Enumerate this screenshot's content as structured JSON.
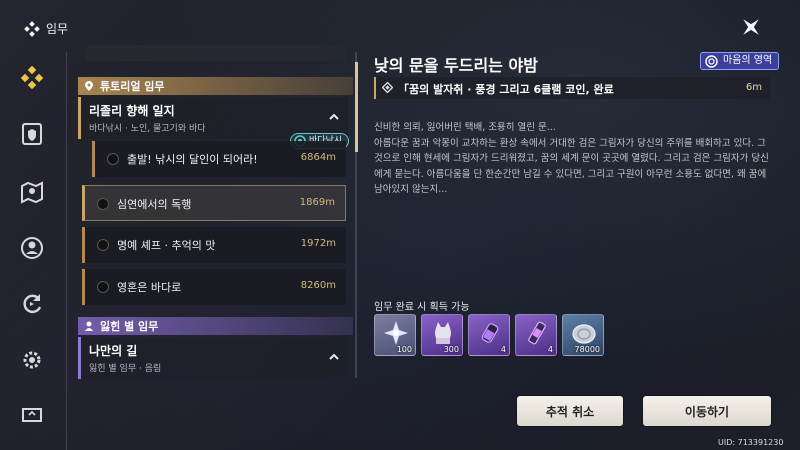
{
  "header": {
    "title": "임무",
    "menu_icon": "quest-diamond-icon",
    "close_icon": "close-star-icon"
  },
  "rail": {
    "items": [
      {
        "name": "quest-icon",
        "active": true
      },
      {
        "name": "shield-card-icon"
      },
      {
        "name": "map-pin-icon"
      },
      {
        "name": "character-icon"
      },
      {
        "name": "refresh-icon"
      },
      {
        "name": "settings-gear-icon"
      },
      {
        "name": "monitor-icon"
      }
    ]
  },
  "list": {
    "tutorial_section": "튜토리얼 임무",
    "group1": {
      "title": "리졸리 향해 일지",
      "subtitle": "바다낚시 · 노인, 물고기와 바다"
    },
    "tag_badge": "바다낚시",
    "quests": [
      {
        "name": "출발! 낚시의 달인이 되어라!",
        "distance": "6864m"
      },
      {
        "name": "심연에서의 독행",
        "distance": "1869m"
      },
      {
        "name": "명예 셰프 · 추억의 맛",
        "distance": "1972m"
      },
      {
        "name": "영혼은 바다로",
        "distance": "8260m"
      }
    ],
    "lost_section": "잃힌 별 임무",
    "group2": {
      "title": "나만의 길",
      "subtitle": "잃힌 별 임무 · 음림"
    }
  },
  "detail": {
    "title": "낮의 문을 두드리는 야밤",
    "realm_badge": "마음의 영역",
    "objective": "「꿈의 발자취 · 풍경 그리고 6클램 코인, 완료",
    "objective_distance": "6m",
    "description": [
      "신비한 의뢰, 잃어버린 택배, 조용히 열린 문...",
      "아름다운 꿈과 악몽이 교차하는 환상 속에서 거대한 검은 그림자가 당신의 주위를 배회하고 있다. 그것으로 인해 현세에 그림자가 드리워졌고, 꿈의 세계 문이 곳곳에 열렸다. 그리고 검은 그림자가 당신에게 묻는다. 아름다움을 단 한순간만 남길 수 있다면, 그리고 구원이 아무런 소용도 없다면, 왜 꿈에 남아있지 않는지..."
    ],
    "reward_label": "임무 완료 시 획득 가능",
    "rewards": [
      {
        "icon": "star-crystal-icon",
        "count": "100"
      },
      {
        "icon": "cat-figure-icon",
        "count": "300"
      },
      {
        "icon": "purple-vial-icon",
        "count": "4"
      },
      {
        "icon": "purple-canister-icon",
        "count": "4"
      },
      {
        "icon": "silver-coin-icon",
        "count": "78000"
      }
    ]
  },
  "buttons": {
    "untrack": "추적 취소",
    "move": "이동하기"
  },
  "uid": "UID: 713391230",
  "colors": {
    "accent_gold": "#c9a66b",
    "lost_purple": "#7660b2",
    "realm_blue": "#3b3f9a"
  }
}
